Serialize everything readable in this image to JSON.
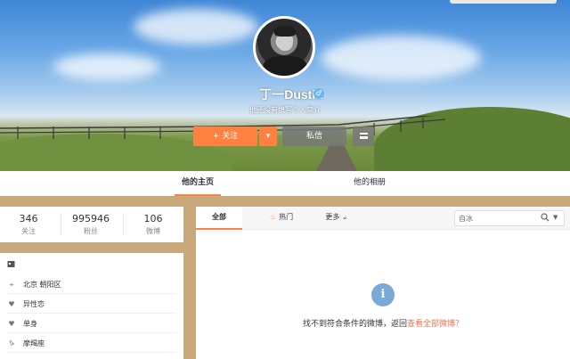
{
  "profile": {
    "name": "丁一Dustin",
    "bio": "他还没有填写个人简介",
    "gender_icon": "male-icon"
  },
  "actions": {
    "follow_label": "+ 关注",
    "message_label": "私信"
  },
  "tabs": [
    {
      "label": "他的主页",
      "active": true
    },
    {
      "label": "他的相册",
      "active": false
    }
  ],
  "stats": [
    {
      "value": "346",
      "label": "关注"
    },
    {
      "value": "995946",
      "label": "粉丝"
    },
    {
      "value": "106",
      "label": "微博"
    }
  ],
  "info": {
    "header_icon": "profile-card-icon",
    "rows": [
      {
        "icon": "location-icon",
        "text": "北京 朝阳区"
      },
      {
        "icon": "heart-icon",
        "text": "异性恋"
      },
      {
        "icon": "relationship-icon",
        "text": "单身"
      },
      {
        "icon": "zodiac-icon",
        "text": "摩羯座"
      }
    ]
  },
  "feed": {
    "tabs": {
      "all": "全部",
      "hot": "热门",
      "more": "更多"
    },
    "search_placeholder": "自冰",
    "empty_message": "找不到符合条件的微博，返回",
    "empty_link": "查看全部微博？"
  },
  "colors": {
    "accent": "#ff8140",
    "page_bg": "#c9a87b",
    "link": "#eb7350",
    "info_icon": "#79a9d6"
  }
}
